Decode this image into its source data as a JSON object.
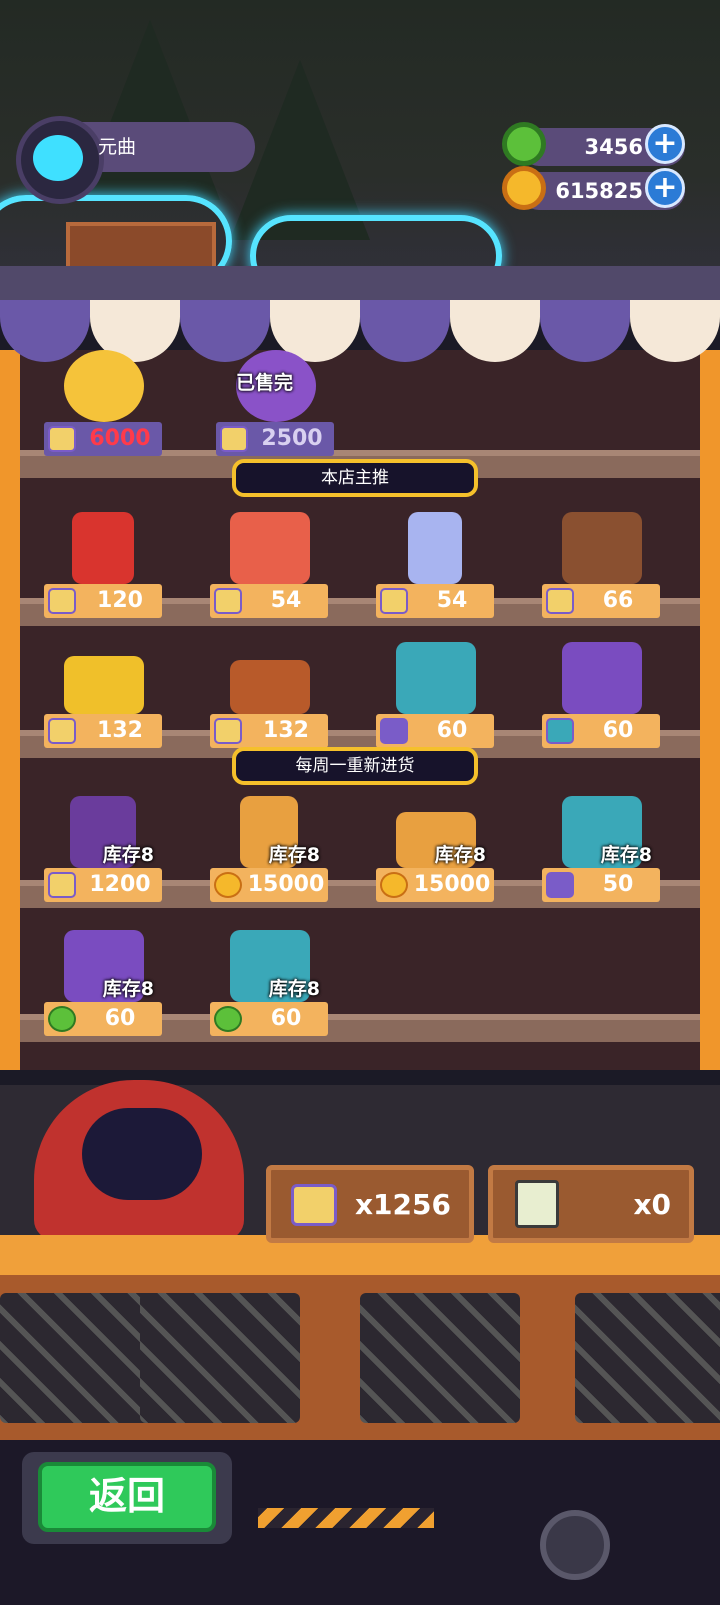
{
  "player": {
    "name": "元曲"
  },
  "currencies": [
    {
      "icon": "green-gem-icon",
      "value": "3456"
    },
    {
      "icon": "gold-planet-coin-icon",
      "value": "615825"
    }
  ],
  "plus_label": "+",
  "featured_row": [
    {
      "icon": "gold-egg-icon",
      "price_icon": "ticket-icon",
      "price": "6000"
    },
    {
      "icon": "purple-egg-icon",
      "price_icon": "ticket-icon",
      "price": "2500",
      "status": "已售完"
    }
  ],
  "banners": {
    "recommended": "本店主推",
    "weekly_restock": "每周一重新进货"
  },
  "recommended_items": [
    {
      "icon": "red-battery-icon",
      "price_icon": "ticket-icon",
      "price": "120"
    },
    {
      "icon": "red-paint-roller-icon",
      "price_icon": "ticket-icon",
      "price": "54"
    },
    {
      "icon": "blue-bottle-icon",
      "price_icon": "ticket-icon",
      "price": "54"
    },
    {
      "icon": "brown-handbag-icon",
      "price_icon": "ticket-icon",
      "price": "66"
    },
    {
      "icon": "yellow-toolbox-icon",
      "price_icon": "ticket-icon",
      "price": "132"
    },
    {
      "icon": "wooden-crate-icon",
      "price_icon": "ticket-icon",
      "price": "132"
    },
    {
      "icon": "teal-house-card-icon",
      "price_icon": "purple-card-icon",
      "price": "60"
    },
    {
      "icon": "purple-refresh-card-icon",
      "price_icon": "teal-card-icon",
      "price": "60"
    }
  ],
  "weekly_items": [
    {
      "icon": "purple-safe-icon",
      "price_icon": "ticket-icon",
      "price": "1200",
      "stock": "库存8"
    },
    {
      "icon": "gold-bolt-icon",
      "price_icon": "gold-coin-icon",
      "price": "15000",
      "stock": "库存8"
    },
    {
      "icon": "gold-nut-icon",
      "price_icon": "gold-coin-icon",
      "price": "15000",
      "stock": "库存8"
    },
    {
      "icon": "teal-house-card-icon",
      "price_icon": "purple-card-icon",
      "price": "50",
      "stock": "库存8"
    },
    {
      "icon": "purple-refresh-card-icon",
      "price_icon": "green-gem-icon",
      "price": "60",
      "stock": "库存8"
    },
    {
      "icon": "teal-house-card-icon",
      "price_icon": "green-gem-icon",
      "price": "60",
      "stock": "库存8"
    }
  ],
  "inventory": [
    {
      "icon": "ticket-icon",
      "value": "x1256"
    },
    {
      "icon": "green-seed-card-icon",
      "value": "x0"
    }
  ],
  "back_button": "返回",
  "colors": {
    "frame": "#f0962b",
    "shelf_bg": "#3a2428",
    "price_tag": "#f3b35e",
    "banner_border": "#f5c02b",
    "back_green": "#2fc95a"
  }
}
